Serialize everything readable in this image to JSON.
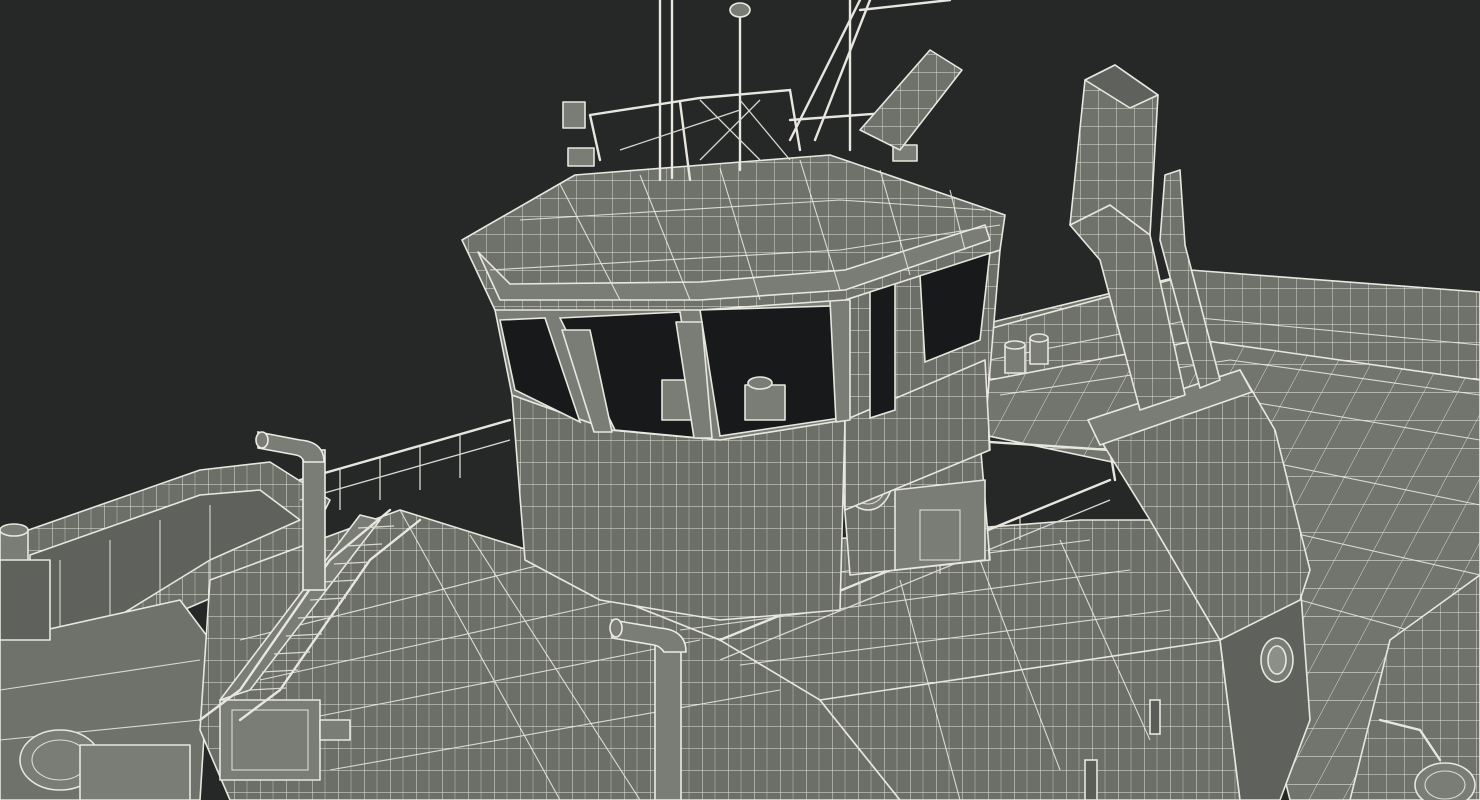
{
  "scene": {
    "subject": "boat-wireframe-render",
    "background_color": "#262727",
    "surface_color": "#6f716b",
    "wire_color": "#e7e7df",
    "window_color": "#17191a"
  }
}
